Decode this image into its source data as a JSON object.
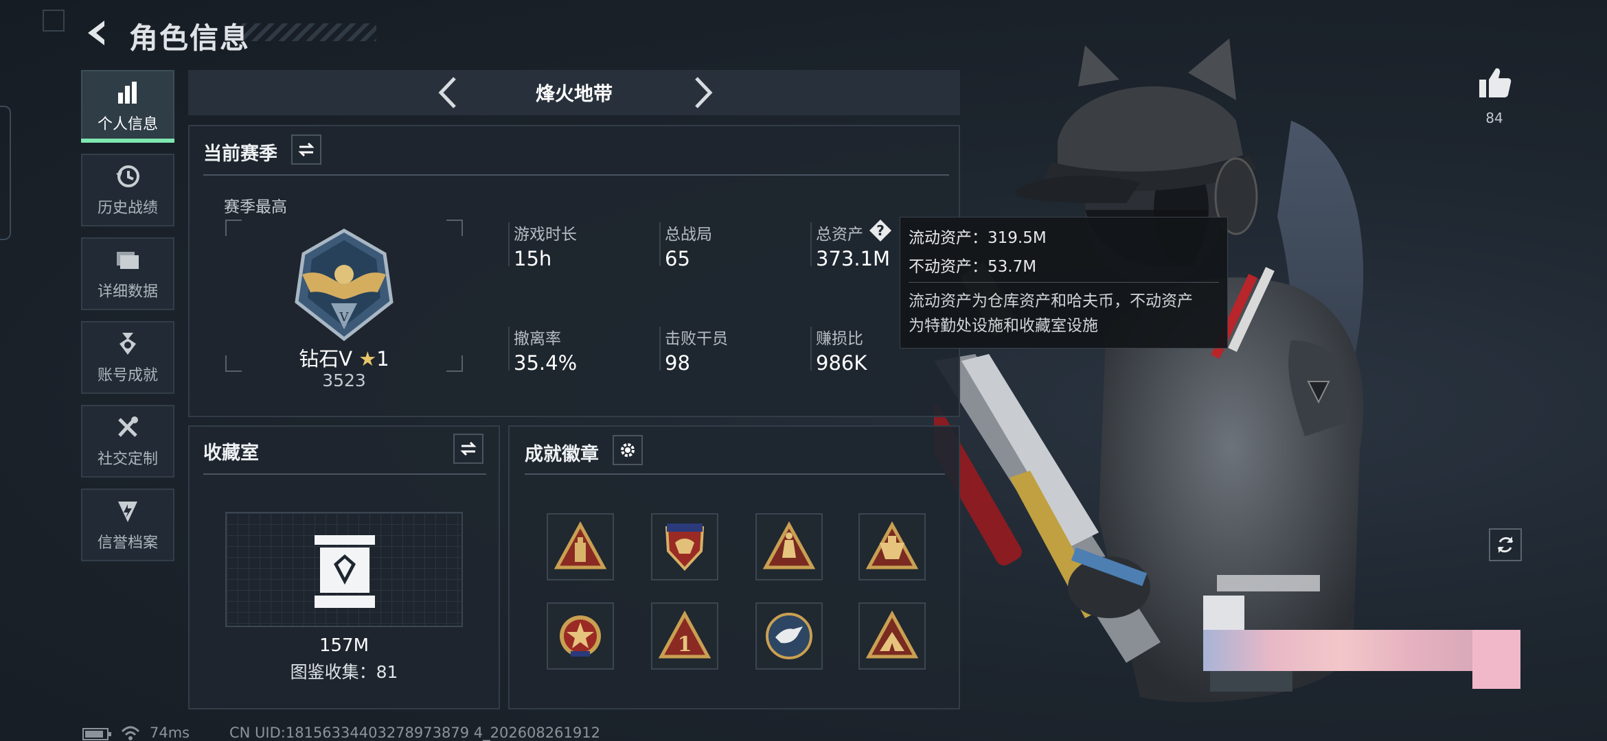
{
  "header": {
    "title": "角色信息"
  },
  "sidebar": {
    "items": [
      {
        "label": "个人信息",
        "icon": "bar-chart-icon",
        "active": true
      },
      {
        "label": "历史战绩",
        "icon": "clock-history-icon"
      },
      {
        "label": "详细数据",
        "icon": "folder-icon"
      },
      {
        "label": "账号成就",
        "icon": "medal-icon"
      },
      {
        "label": "社交定制",
        "icon": "tools-icon"
      },
      {
        "label": "信誉档案",
        "icon": "shield-bolt-icon"
      }
    ]
  },
  "mode": {
    "name": "烽火地带"
  },
  "season": {
    "title": "当前赛季",
    "best_label": "赛季最高",
    "rank_name": "钻石V",
    "rank_stars": "1",
    "rank_score": "3523",
    "stats": [
      {
        "label": "游戏时长",
        "value": "15h"
      },
      {
        "label": "总战局",
        "value": "65"
      },
      {
        "label": "总资产",
        "value": "373.1M"
      },
      {
        "label": "撤离率",
        "value": "35.4%"
      },
      {
        "label": "击败干员",
        "value": "98"
      },
      {
        "label": "赚损比",
        "value": "986K"
      }
    ]
  },
  "tooltip": {
    "liquid": "流动资产：319.5M",
    "fixed": "不动资产：53.7M",
    "desc_line1": "流动资产为仓库资产和哈夫币，不动资产",
    "desc_line2": "为特勤处设施和收藏室设施"
  },
  "collection": {
    "title": "收藏室",
    "value": "157M",
    "catalog": "图鉴收集：81"
  },
  "achievements": {
    "title": "成就徽章",
    "badges": [
      "triangle-bottle-badge-icon",
      "eagle-crest-badge-icon",
      "triangle-lantern-badge-icon",
      "triangle-trophy-badge-icon",
      "star-medal-badge-icon",
      "triangle-one-badge-icon",
      "eagle-round-badge-icon",
      "triangle-camp-badge-icon"
    ]
  },
  "like": {
    "count": "84"
  },
  "status": {
    "ping": "74ms",
    "uid": "CN UID:18156334403278973879 4_202608261912"
  },
  "colors": {
    "accent": "#7fe8b0",
    "panel_bg": "#1e262f",
    "gold": "#c8a050"
  }
}
